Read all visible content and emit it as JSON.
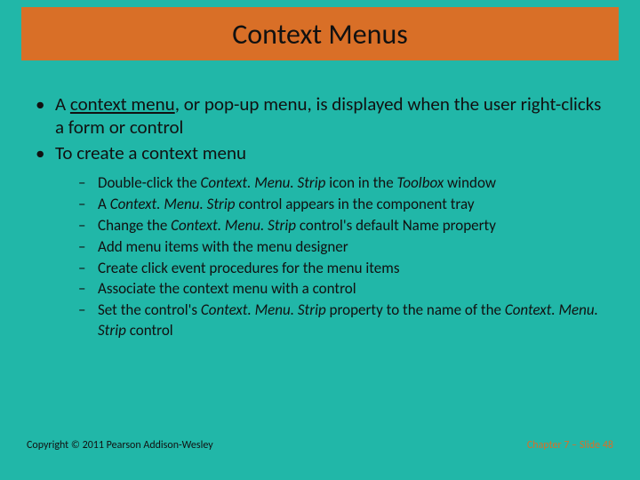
{
  "title": "Context Menus",
  "bullets": {
    "b1_pre": "A ",
    "b1_term": "context menu",
    "b1_post": ", or pop-up menu, is displayed when the user right-clicks a form or control",
    "b2": "To create a context menu"
  },
  "sub": {
    "s1_a": "Double-click the ",
    "s1_b": "Context. Menu. Strip",
    "s1_c": " icon in the ",
    "s1_d": "Toolbox",
    "s1_e": " window",
    "s2_a": "A ",
    "s2_b": "Context. Menu. Strip",
    "s2_c": " control appears in the component tray",
    "s3_a": "Change the ",
    "s3_b": "Context. Menu. Strip",
    "s3_c": " control's default Name property",
    "s4": "Add menu items with the menu designer",
    "s5": "Create click event procedures for the menu items",
    "s6": "Associate the context menu with a control",
    "s7_a": "Set the control's ",
    "s7_b": "Context. Menu. Strip",
    "s7_c": " property to the name of the ",
    "s7_d": "Context. Menu. Strip",
    "s7_e": " control"
  },
  "footer": {
    "left": "Copyright © 2011 Pearson Addison-Wesley",
    "right": "Chapter 7 – Slide 48"
  }
}
